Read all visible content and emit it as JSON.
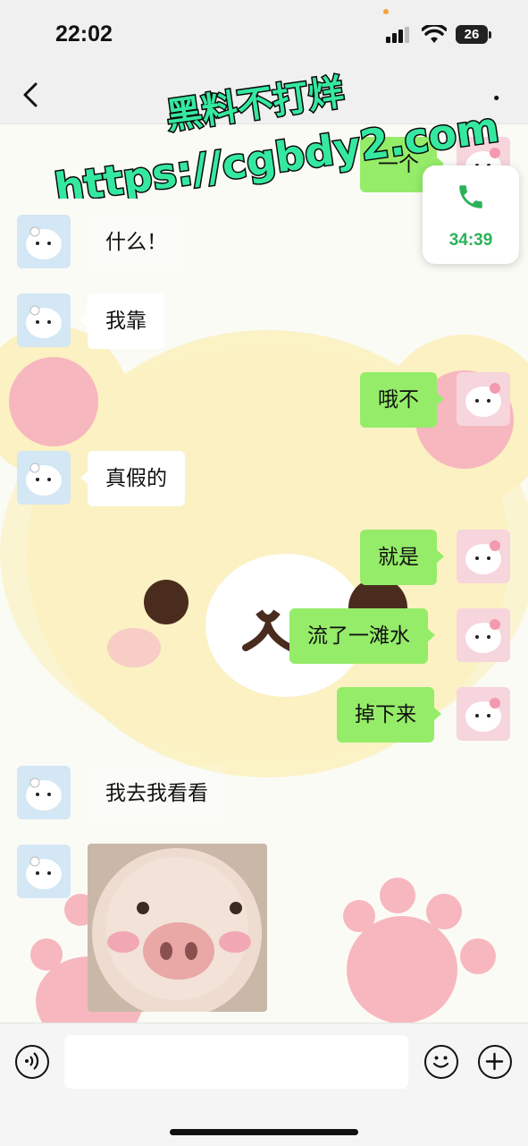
{
  "status_bar": {
    "time": "22:02",
    "battery": "26"
  },
  "call": {
    "duration": "34:39"
  },
  "watermark": {
    "line1": "黑料不打烊",
    "line2": "https://cgbdy2.com"
  },
  "messages": [
    {
      "side": "out",
      "text": "一个"
    },
    {
      "side": "in",
      "text": "什么！"
    },
    {
      "side": "in",
      "text": "我靠"
    },
    {
      "side": "out",
      "text": "哦不"
    },
    {
      "side": "in",
      "text": "真假的"
    },
    {
      "side": "out",
      "text": "就是"
    },
    {
      "side": "out",
      "text": "流了一滩水"
    },
    {
      "side": "out",
      "text": "掉下来"
    },
    {
      "side": "in",
      "text": "我去我看看"
    },
    {
      "side": "in",
      "text": "[pig sticker]"
    }
  ],
  "input": {
    "value": ""
  },
  "colors": {
    "outgoing_bubble": "#95ec69",
    "incoming_bubble": "#ffffff",
    "call_green": "#2bb25a"
  }
}
